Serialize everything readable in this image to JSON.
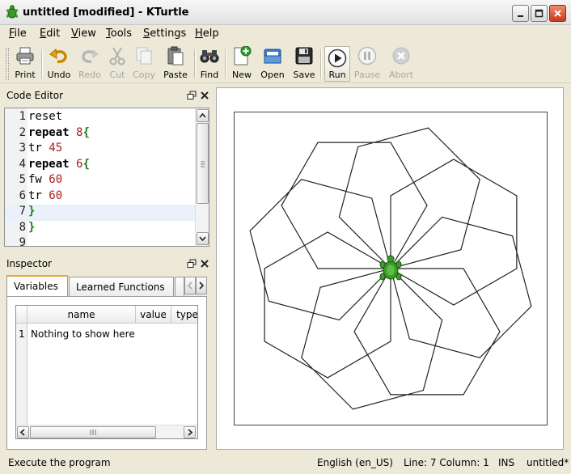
{
  "window": {
    "title": "untitled [modified] - KTurtle"
  },
  "menu": [
    {
      "label": "File",
      "u": "F",
      "rest": "ile"
    },
    {
      "label": "Edit",
      "u": "E",
      "rest": "dit"
    },
    {
      "label": "View",
      "u": "V",
      "rest": "iew"
    },
    {
      "label": "Tools",
      "u": "T",
      "rest": "ools"
    },
    {
      "label": "Settings",
      "u": "S",
      "rest": "ettings"
    },
    {
      "label": "Help",
      "u": "H",
      "rest": "elp"
    }
  ],
  "toolbar": {
    "print": "Print",
    "undo": "Undo",
    "redo": "Redo",
    "cut": "Cut",
    "copy": "Copy",
    "paste": "Paste",
    "find": "Find",
    "new": "New",
    "open": "Open",
    "save": "Save",
    "run": "Run",
    "pause": "Pause",
    "abort": "Abort"
  },
  "code_editor": {
    "title": "Code Editor",
    "current_line": 7,
    "lines": [
      {
        "n": "1",
        "text": "reset"
      },
      {
        "n": "2",
        "text": "repeat 8{"
      },
      {
        "n": "3",
        "text": "tr 45"
      },
      {
        "n": "4",
        "text": "repeat 6{"
      },
      {
        "n": "5",
        "text": "fw 60"
      },
      {
        "n": "6",
        "text": "tr 60"
      },
      {
        "n": "7",
        "text": "}"
      },
      {
        "n": "8",
        "text": "}"
      },
      {
        "n": "9",
        "text": ""
      }
    ]
  },
  "inspector": {
    "title": "Inspector",
    "tabs": [
      "Variables",
      "Learned Functions"
    ],
    "active_tab": "Variables",
    "columns": [
      "name",
      "value",
      "type"
    ],
    "rows": [
      {
        "index": "1",
        "text": "Nothing to show here"
      }
    ]
  },
  "canvas": {
    "program": {
      "repeat_outer": 8,
      "turn_outer": 45,
      "repeat_inner": 6,
      "forward": 60,
      "turn_inner": 60
    },
    "pen_color": "#222222",
    "turtle_color": "#3a9a2a"
  },
  "statusbar": {
    "message": "Execute the program",
    "language": "English (en_US)",
    "position": "Line: 7 Column: 1",
    "mode": "INS",
    "file": "untitled*"
  },
  "colors": {
    "background": "#ece9d8",
    "tab_accent": "#f0a232",
    "current_line": "#eaf1fb"
  }
}
